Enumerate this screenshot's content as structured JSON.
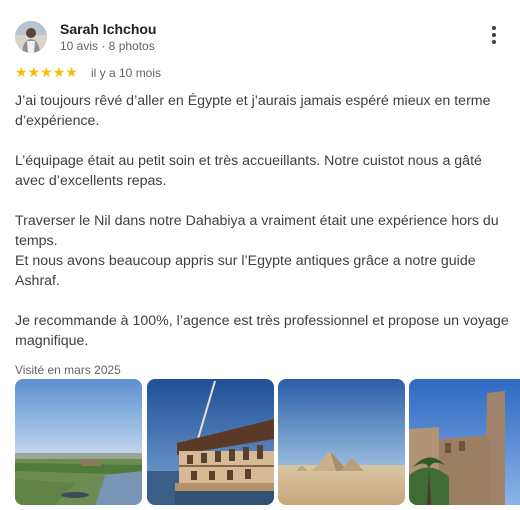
{
  "user": {
    "name": "Sarah Ichchou",
    "meta": "10 avis · 8 photos"
  },
  "rating": {
    "stars": "★★★★★",
    "value": 5,
    "max": 5,
    "date": "il y a 10 mois"
  },
  "review": {
    "paragraphs": [
      "J’ai toujours rêvé d’aller en Égypte et j’aurais jamais espéré mieux en terme d’expérience.",
      "L’équipage était au petit soin et très accueillants. Notre cuistot nous a gâté avec d’excellents repas.",
      "Traverser le Nil dans notre Dahabiya a vraiment était une expérience hors du temps.\nEt nous avons beaucoup appris sur l’Egypte antiques grâce a notre guide Ashraf.",
      "Je recommande à 100%, l’agence est très professionnel et propose un voyage magnifique."
    ]
  },
  "visited": "Visité en mars 2025",
  "colors": {
    "star": "#fbbc04",
    "text_primary": "#202124",
    "text_secondary": "#5f6368"
  },
  "icons": {
    "more": "more-vert-icon",
    "star": "star-icon"
  }
}
